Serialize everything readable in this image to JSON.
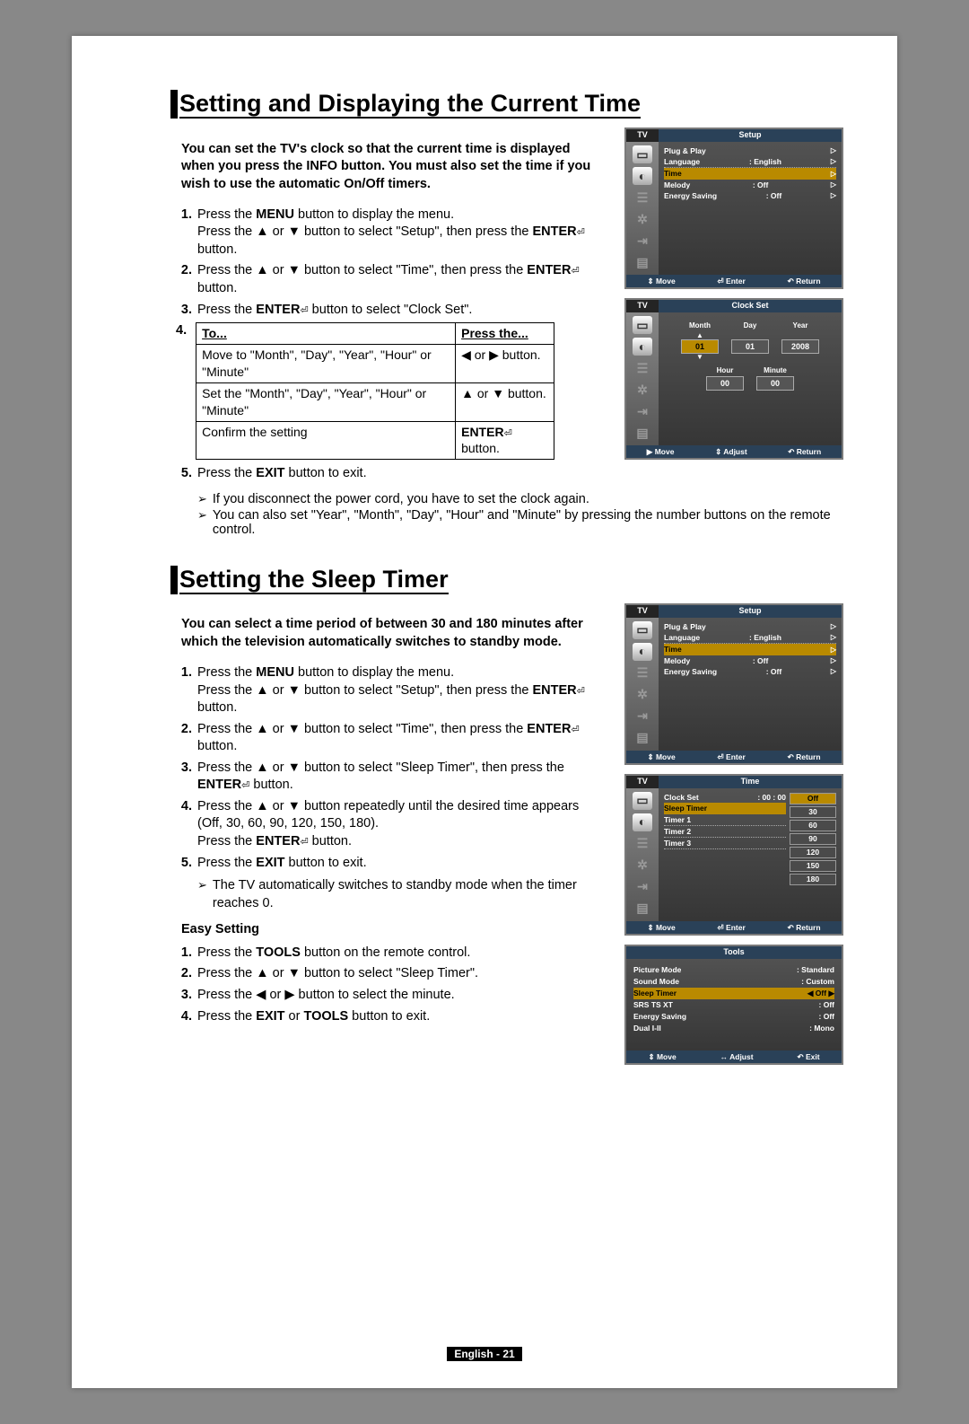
{
  "s1": {
    "heading": "Setting and Displaying the Current Time",
    "intro": "You can set the TV's clock so that the current time is displayed when you press the INFO button. You must also set the time if you wish to use the automatic On/Off timers.",
    "step1a": "Press the ",
    "step1b": "MENU",
    "step1c": " button to display the menu.",
    "step1d": "Press the ▲ or ▼ button to select \"Setup\", then press the ",
    "step1e": "ENTER",
    "step1f": " button.",
    "step2a": "Press the ▲ or ▼ button to select \"Time\", then press the ",
    "step2b": "ENTER",
    "step2c": " button.",
    "step3a": "Press the ",
    "step3b": "ENTER",
    "step3c": " button to select \"Clock Set\".",
    "step4num": "4.",
    "tbl_h1": "To...",
    "tbl_h2": "Press the...",
    "tbl_r1c1": "Move to \"Month\", \"Day\", \"Year\", \"Hour\" or \"Minute\"",
    "tbl_r1c2": "◀ or ▶ button.",
    "tbl_r2c1": "Set the \"Month\", \"Day\", \"Year\", \"Hour\" or \"Minute\"",
    "tbl_r2c2": "▲ or ▼ button.",
    "tbl_r3c1": "Confirm the setting",
    "tbl_r3c2a": "ENTER",
    "tbl_r3c2b": " button.",
    "step5a": "Press the ",
    "step5b": "EXIT",
    "step5c": " button to exit.",
    "note1": "If you disconnect the power cord, you have to set the clock again.",
    "note2": "You can also set \"Year\", \"Month\", \"Day\", \"Hour\" and \"Minute\" by pressing the number buttons on the remote control."
  },
  "s2": {
    "heading": "Setting the Sleep Timer",
    "intro": "You can select a time period of between 30 and 180 minutes after which the television automatically switches to standby mode.",
    "step1a": "Press the ",
    "step1b": "MENU",
    "step1c": " button to display the menu.",
    "step1d": "Press the ▲ or ▼ button to select \"Setup\", then press the ",
    "step1e": "ENTER",
    "step1f": " button.",
    "step2a": "Press the ▲ or ▼ button to select \"Time\", then press the ",
    "step2b": "ENTER",
    "step2c": " button.",
    "step3a": "Press the ▲ or ▼ button to select \"Sleep Timer\", then press the ",
    "step3b": "ENTER",
    "step3c": " button.",
    "step4a": "Press the ▲ or ▼ button repeatedly until the desired time appears (Off, 30, 60, 90, 120, 150, 180).",
    "step4b": "Press the ",
    "step4c": "ENTER",
    "step4d": " button.",
    "step5a": "Press the ",
    "step5b": "EXIT",
    "step5c": " button to exit.",
    "note1": "The TV automatically switches to standby mode when the timer reaches 0.",
    "easy_heading": "Easy Setting",
    "e1a": "Press the ",
    "e1b": "TOOLS",
    "e1c": " button on the remote control.",
    "e2": "Press the ▲ or ▼ button to select \"Sleep Timer\".",
    "e3": "Press the ◀ or ▶ button to select the minute.",
    "e4a": "Press the ",
    "e4b": "EXIT",
    "e4c": " or ",
    "e4d": "TOOLS",
    "e4e": " button to exit."
  },
  "osd": {
    "tv": "TV",
    "setup": "Setup",
    "plug_play": "Plug & Play",
    "language": "Language",
    "english": ": English",
    "time": "Time",
    "melody": "Melody",
    "off": ": Off",
    "energy": "Energy Saving",
    "move": "Move",
    "enter": "Enter",
    "return": "Return",
    "adjust": "Adjust",
    "exit": "Exit",
    "arrow": "▷"
  },
  "clock": {
    "title": "Clock Set",
    "month": "Month",
    "day": "Day",
    "year": "Year",
    "hour": "Hour",
    "minute": "Minute",
    "v_month": "01",
    "v_day": "01",
    "v_year": "2008",
    "v_hour": "00",
    "v_minute": "00"
  },
  "time_menu": {
    "title": "Time",
    "clock_set": "Clock Set",
    "clock_val": ": 00 : 00",
    "sleep": "Sleep Timer",
    "t1": "Timer 1",
    "t2": "Timer 2",
    "t3": "Timer 3",
    "opts": {
      "off": "Off",
      "30": "30",
      "60": "60",
      "90": "90",
      "120": "120",
      "150": "150",
      "180": "180"
    }
  },
  "tools": {
    "title": "Tools",
    "picture": "Picture Mode",
    "picture_v": ": Standard",
    "sound": "Sound Mode",
    "sound_v": ": Custom",
    "sleep": "Sleep Timer",
    "sleep_v": "Off",
    "srs": "SRS TS XT",
    "srs_v": ": Off",
    "energy": "Energy Saving",
    "energy_v": ": Off",
    "dual": "Dual I-II",
    "dual_v": ": Mono"
  },
  "footer": {
    "lang": "English - ",
    "page": "21"
  },
  "icons": {
    "updown": "⇕",
    "enter": "⏎",
    "return": "↶",
    "right": "▶",
    "leftright": "↔",
    "left": "◀",
    "rightsm": "▶"
  }
}
